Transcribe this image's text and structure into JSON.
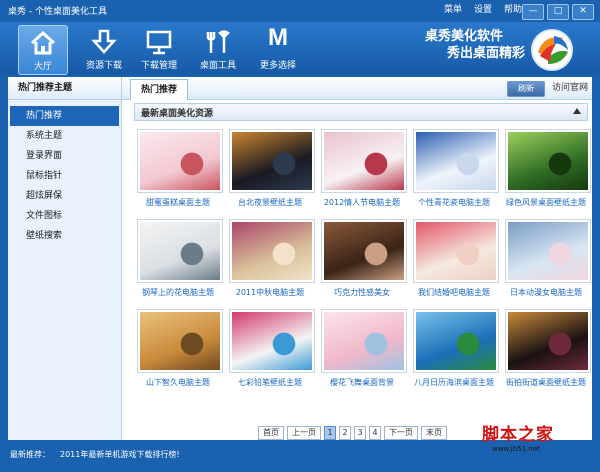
{
  "window": {
    "title": "桌秀 - 个性桌面美化工具",
    "menu": [
      "菜单",
      "设置",
      "帮助"
    ],
    "buttons": [
      "—",
      "□",
      "✕"
    ]
  },
  "toolbar": {
    "items": [
      {
        "label": "大厅",
        "icon": "home-icon"
      },
      {
        "label": "资源下载",
        "icon": "download-arrow-icon"
      },
      {
        "label": "下载管理",
        "icon": "monitor-icon"
      },
      {
        "label": "桌面工具",
        "icon": "tools-icon"
      },
      {
        "label": "更多选择",
        "icon": "letter-m-icon",
        "glyph": "M"
      }
    ],
    "active": "大厅"
  },
  "brand": {
    "slogan_line1": "桌秀美化软件",
    "slogan_line2": "秀出桌面精彩"
  },
  "sidebar": {
    "header": "热门推荐主题",
    "items": [
      "热门推荐",
      "系统主题",
      "登录界面",
      "鼠标指针",
      "超炫屏保",
      "文件图标",
      "壁纸搜索"
    ],
    "active": "热门推荐"
  },
  "main": {
    "tab": "热门推荐",
    "refresh_label": "刷新",
    "official_link": "访问官网",
    "section_title": "最新桌面美化资源"
  },
  "thumbnails": [
    {
      "caption": "甜蜜蛋糕桌面主题",
      "colors": [
        "#f3c9d2",
        "#fbe8ee",
        "#c9555f"
      ]
    },
    {
      "caption": "台北夜景壁纸主题",
      "colors": [
        "#1a1a24",
        "#c9852f",
        "#2c3a4f"
      ]
    },
    {
      "caption": "2012情人节电脑主题",
      "colors": [
        "#f7f2f4",
        "#e9c2cc",
        "#b7384a"
      ]
    },
    {
      "caption": "个性青花瓷电脑主题",
      "colors": [
        "#eef4fb",
        "#2b5fb0",
        "#c9d8ec"
      ]
    },
    {
      "caption": "绿色风景桌面壁纸主题",
      "colors": [
        "#2f6d25",
        "#9ccf5a",
        "#16380f"
      ]
    },
    {
      "caption": "钢琴上的花电脑主题",
      "colors": [
        "#d9dfe3",
        "#f4f4f4",
        "#6b7c88"
      ]
    },
    {
      "caption": "2011中秋电脑主题",
      "colors": [
        "#d9c19a",
        "#a9466a",
        "#f1e2c9"
      ]
    },
    {
      "caption": "巧克力性感美女",
      "colors": [
        "#3a2316",
        "#8a5a3c",
        "#c9a083"
      ]
    },
    {
      "caption": "我们结婚吧电脑主题",
      "colors": [
        "#f4e9df",
        "#e35769",
        "#efcfc3"
      ]
    },
    {
      "caption": "日本动漫女电脑主题",
      "colors": [
        "#d8e6f3",
        "#7a9cc4",
        "#f1d5df"
      ]
    },
    {
      "caption": "山下智久电脑主题",
      "colors": [
        "#c98a3c",
        "#e9c27b",
        "#6e4a22"
      ]
    },
    {
      "caption": "七彩铅笔壁纸主题",
      "colors": [
        "#f4f4f4",
        "#d23a6c",
        "#3b9ad6"
      ]
    },
    {
      "caption": "樱花飞舞桌面背景",
      "colors": [
        "#f1b7ca",
        "#fbe4ec",
        "#9fc2e3"
      ]
    },
    {
      "caption": "八月日历海滨桌面主题",
      "colors": [
        "#1a6fb8",
        "#79c1e9",
        "#2b8a3d"
      ]
    },
    {
      "caption": "街拍街道桌面壁纸主题",
      "colors": [
        "#1a1212",
        "#c98a3c",
        "#6e2a3c"
      ]
    }
  ],
  "pager": {
    "first": "首页",
    "prev": "上一页",
    "pages": [
      "1",
      "2",
      "3",
      "4"
    ],
    "current": "1",
    "next": "下一页",
    "last": "末页"
  },
  "status": {
    "label": "最新推荐：",
    "text": "2011年最新单机游戏下载排行榜!"
  },
  "watermark": {
    "text": "脚本之家",
    "url": "www.jb51.net"
  }
}
